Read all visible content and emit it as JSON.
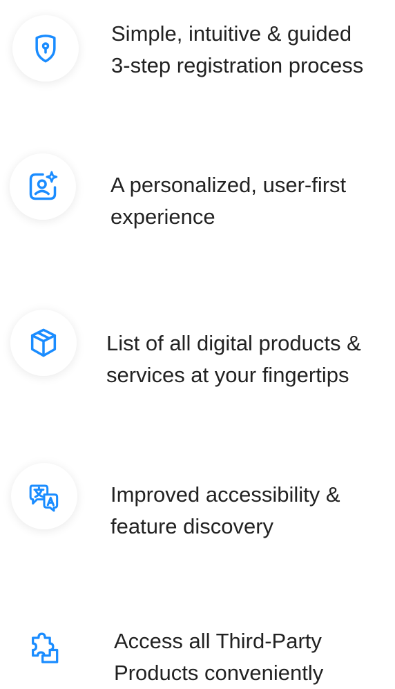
{
  "features": [
    {
      "icon": "shield-keyhole-icon",
      "line1": "Simple, intuitive & guided",
      "line2": "3-step registration process"
    },
    {
      "icon": "user-sparkle-icon",
      "line1": "A personalized, user-first",
      "line2": "experience"
    },
    {
      "icon": "package-box-icon",
      "line1": "List of all digital products &",
      "line2": "services at your fingertips"
    },
    {
      "icon": "translate-icon",
      "line1": "Improved accessibility &",
      "line2": "feature discovery"
    },
    {
      "icon": "puzzle-piece-icon",
      "line1": "Access all Third-Party",
      "line2": "Products conveniently"
    }
  ],
  "colors": {
    "icon_accent": "#1A8CFF",
    "text": "#222222",
    "circle_bg": "#FFFFFF"
  }
}
